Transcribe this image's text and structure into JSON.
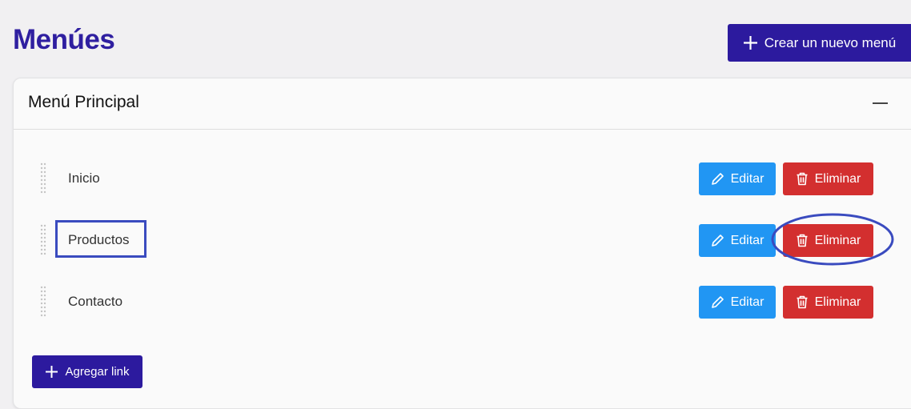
{
  "page": {
    "title": "Menúes"
  },
  "header": {
    "create_button_label": "Crear un nuevo menú"
  },
  "menu": {
    "title": "Menú Principal",
    "items": [
      {
        "label": "Inicio",
        "edit_label": "Editar",
        "delete_label": "Eliminar"
      },
      {
        "label": "Productos",
        "edit_label": "Editar",
        "delete_label": "Eliminar"
      },
      {
        "label": "Contacto",
        "edit_label": "Editar",
        "delete_label": "Eliminar"
      }
    ],
    "add_link_label": "Agregar link"
  },
  "colors": {
    "title": "#2f1fa0",
    "primary": "#2c1a9e",
    "edit": "#2196f3",
    "delete": "#d32f2f",
    "annotation": "#3a4bbf"
  },
  "icons": [
    "plus-icon",
    "minus-icon",
    "pencil-icon",
    "trash-icon",
    "drag-handle-icon"
  ]
}
